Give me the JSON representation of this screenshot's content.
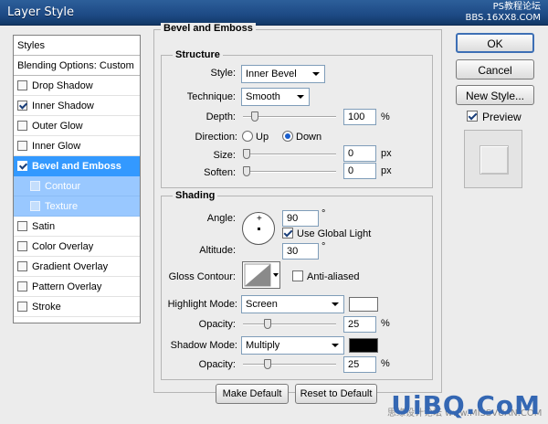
{
  "window": {
    "title": "Layer Style"
  },
  "watermark_top": {
    "line1": "PS教程论坛",
    "line2": "BBS.16XX8.COM"
  },
  "watermark_bottom": {
    "text": "UiBQ.CoM",
    "sub": "思缘设计论坛 www.MISSVUAN.COM"
  },
  "styles_panel": {
    "header": "Styles",
    "blending": "Blending Options: Custom",
    "items": [
      {
        "label": "Drop Shadow",
        "checked": false
      },
      {
        "label": "Inner Shadow",
        "checked": true
      },
      {
        "label": "Outer Glow",
        "checked": false
      },
      {
        "label": "Inner Glow",
        "checked": false
      },
      {
        "label": "Bevel and Emboss",
        "checked": true,
        "active": true
      },
      {
        "label": "Contour",
        "checked": false,
        "sub": true
      },
      {
        "label": "Texture",
        "checked": false,
        "sub": true
      },
      {
        "label": "Satin",
        "checked": false
      },
      {
        "label": "Color Overlay",
        "checked": false
      },
      {
        "label": "Gradient Overlay",
        "checked": false
      },
      {
        "label": "Pattern Overlay",
        "checked": false
      },
      {
        "label": "Stroke",
        "checked": false
      }
    ]
  },
  "bevel": {
    "title": "Bevel and Emboss",
    "structure": {
      "title": "Structure",
      "style_label": "Style:",
      "style_value": "Inner Bevel",
      "technique_label": "Technique:",
      "technique_value": "Smooth",
      "depth_label": "Depth:",
      "depth_value": "100",
      "depth_unit": "%",
      "direction_label": "Direction:",
      "dir_up": "Up",
      "dir_down": "Down",
      "size_label": "Size:",
      "size_value": "0",
      "size_unit": "px",
      "soften_label": "Soften:",
      "soften_value": "0",
      "soften_unit": "px"
    },
    "shading": {
      "title": "Shading",
      "angle_label": "Angle:",
      "angle_value": "90",
      "angle_unit": "°",
      "global_light": "Use Global Light",
      "altitude_label": "Altitude:",
      "altitude_value": "30",
      "altitude_unit": "°",
      "gloss_label": "Gloss Contour:",
      "anti_aliased": "Anti-aliased",
      "highlight_label": "Highlight Mode:",
      "highlight_value": "Screen",
      "highlight_color": "#ffffff",
      "hl_opacity_label": "Opacity:",
      "hl_opacity_value": "25",
      "hl_opacity_unit": "%",
      "shadow_label": "Shadow Mode:",
      "shadow_value": "Multiply",
      "shadow_color": "#000000",
      "sh_opacity_label": "Opacity:",
      "sh_opacity_value": "25",
      "sh_opacity_unit": "%"
    },
    "make_default": "Make Default",
    "reset_default": "Reset to Default"
  },
  "buttons": {
    "ok": "OK",
    "cancel": "Cancel",
    "new_style": "New Style...",
    "preview": "Preview"
  }
}
